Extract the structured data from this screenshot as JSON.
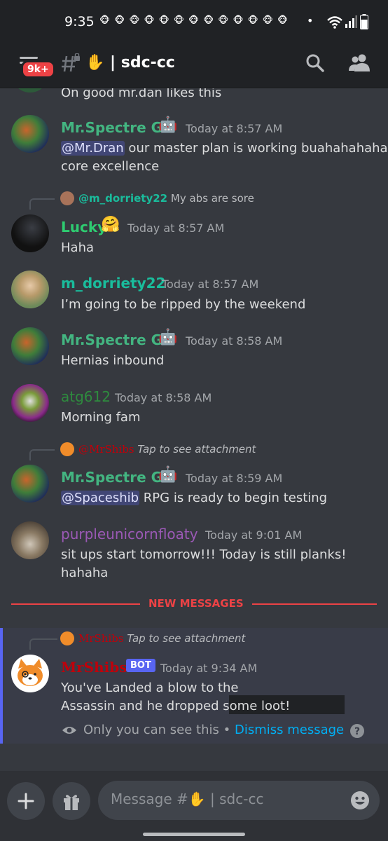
{
  "status_bar": {
    "time": "9:35",
    "notif_icons": "🐵 🐵 🐵 🐵 🐵 🐵 🐵 🐵 🐵 🐵 🐵 🐵 🐵",
    "dot": "•"
  },
  "header": {
    "unread_badge": "9k+",
    "channel": "✋ | sdc-cc"
  },
  "messages": {
    "partial_text": "On good mr.dan likes this",
    "m1": {
      "user": "Mr.Spectre G.",
      "emoji": "🤖",
      "time": "Today at 8:57 AM",
      "mention": "@Mr.Dran",
      "text_after_mention": " our master plan is working buahahahahaa",
      "line2": "core excellence"
    },
    "m2": {
      "reply_user": "@m_dorriety22",
      "reply_text": "My abs are sore",
      "user": "Lucky",
      "emoji": "🤗",
      "time": "Today at 8:57 AM",
      "text": "Haha"
    },
    "m3": {
      "user": "m_dorriety22",
      "time": "Today at 8:57 AM",
      "text": "I’m going to be ripped by the weekend"
    },
    "m4": {
      "user": "Mr.Spectre G.",
      "emoji": "🤖",
      "time": "Today at 8:58 AM",
      "text": "Hernias inbound"
    },
    "m5": {
      "user": "atg612",
      "time": "Today at 8:58 AM",
      "text": "Morning fam"
    },
    "m6": {
      "reply_user": "@MrShibs",
      "reply_text": "Tap to see attachment",
      "user": "Mr.Spectre G.",
      "emoji": "🤖",
      "time": "Today at 8:59 AM",
      "mention": "@Spaceshib",
      "text_after_mention": " RPG is ready to begin testing"
    },
    "m7": {
      "user": "purpleunicornfloaty",
      "time": "Today at 9:01 AM",
      "line1": "sit ups start tomorrow!!!   Today is still planks!",
      "line2": "hahaha"
    },
    "new_messages_label": "NEW MESSAGES",
    "m8": {
      "reply_user": "MrShibs",
      "reply_text": "Tap to see attachment",
      "user": "MrShibs",
      "bot_label": "BOT",
      "time": "Today at 9:34 AM",
      "line1": "You've Landed a blow to the",
      "line2": "Assassin and he dropped some loot!",
      "only_you": "Only you can see this •",
      "dismiss": "Dismiss message"
    }
  },
  "composer": {
    "placeholder": "Message #✋ | sdc-cc"
  },
  "colors": {
    "spectre": "#43b581",
    "lucky": "#2ecc71",
    "dorriety": "#1abc9c",
    "atg": "#2e8b3e",
    "purple": "#9b59b6",
    "mrshibs": "#c0000a",
    "accent": "#5865f2",
    "new_messages": "#ed4245"
  }
}
